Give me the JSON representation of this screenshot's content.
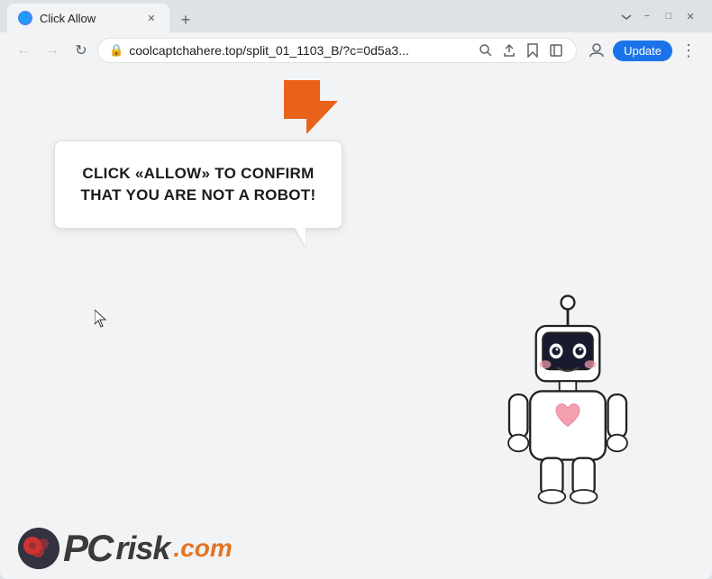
{
  "window": {
    "title": "Click Allow",
    "favicon": "●"
  },
  "titlebar": {
    "minimize_label": "−",
    "maximize_label": "□",
    "close_label": "✕",
    "new_tab_label": "+",
    "tab_close_label": "✕"
  },
  "navbar": {
    "back_label": "←",
    "forward_label": "→",
    "reload_label": "↻",
    "address": "coolcaptchahere.top/split_01_1103_B/?c=0d5a3...",
    "lock_icon": "🔒",
    "search_icon": "🔍",
    "share_icon": "↗",
    "bookmark_icon": "☆",
    "sidebar_icon": "⬜",
    "profile_icon": "👤",
    "update_label": "Update",
    "more_label": "⋮"
  },
  "page": {
    "bubble_text": "CLICK «ALLOW» TO CONFIRM THAT YOU ARE NOT A ROBOT!"
  },
  "watermark": {
    "pc_label": "PC",
    "risk_label": "risk",
    "dot_com": ".com"
  },
  "colors": {
    "orange_arrow": "#e8621a",
    "update_btn_bg": "#1a73e8",
    "tab_bg": "#f1f3f4",
    "nav_bg": "#f1f3f4",
    "page_bg": "#f1f3f4"
  }
}
